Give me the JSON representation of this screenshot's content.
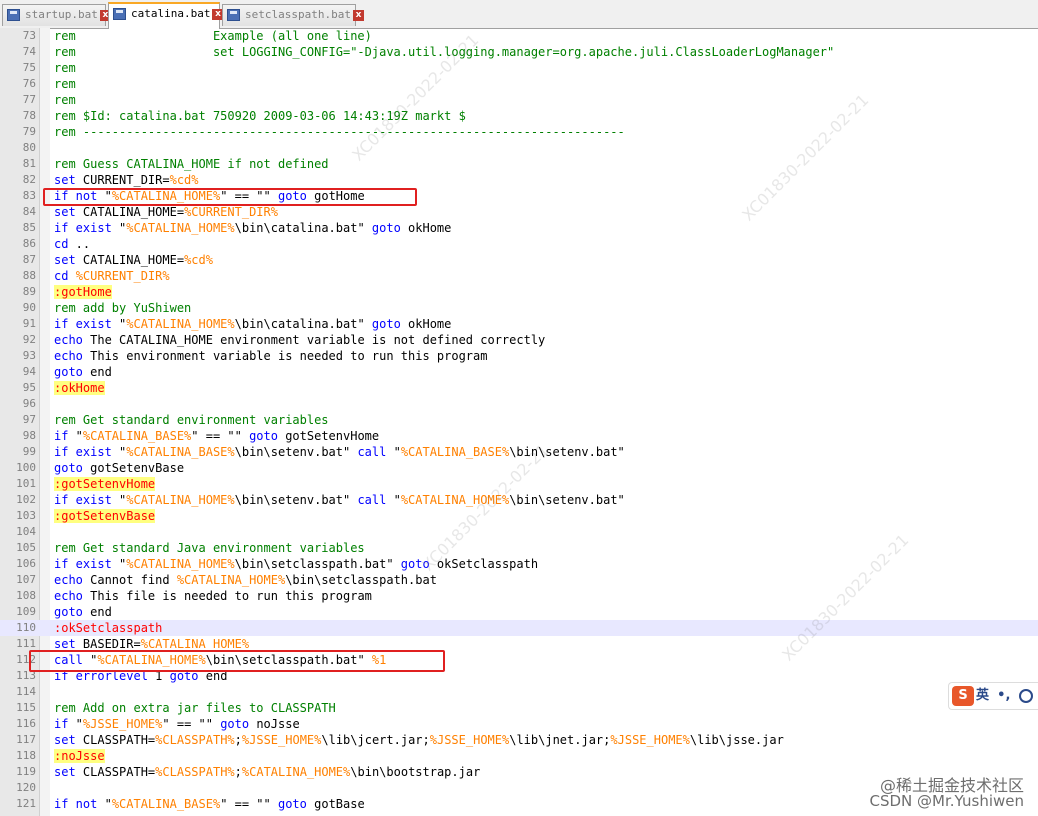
{
  "tabs": [
    {
      "label": "startup.bat",
      "active": false
    },
    {
      "label": "catalina.bat",
      "active": true
    },
    {
      "label": "setclasspath.bat",
      "active": false
    }
  ],
  "lines": [
    {
      "n": "73",
      "t": [
        [
          "cm",
          "rem                   Example (all one line)"
        ]
      ]
    },
    {
      "n": "74",
      "t": [
        [
          "cm",
          "rem                   set LOGGING_CONFIG=\"-Djava.util.logging.manager=org.apache.juli.ClassLoaderLogManager\""
        ]
      ]
    },
    {
      "n": "75",
      "t": [
        [
          "cm",
          "rem"
        ]
      ]
    },
    {
      "n": "76",
      "t": [
        [
          "cm",
          "rem"
        ]
      ]
    },
    {
      "n": "77",
      "t": [
        [
          "cm",
          "rem"
        ]
      ]
    },
    {
      "n": "78",
      "t": [
        [
          "cm",
          "rem $Id: catalina.bat 750920 2009-03-06 14:43:19Z markt $"
        ]
      ]
    },
    {
      "n": "79",
      "t": [
        [
          "cm",
          "rem ---------------------------------------------------------------------------"
        ]
      ]
    },
    {
      "n": "80",
      "t": []
    },
    {
      "n": "81",
      "t": [
        [
          "cm",
          "rem Guess CATALINA_HOME if not defined"
        ]
      ]
    },
    {
      "n": "82",
      "t": [
        [
          "kw",
          "set"
        ],
        [
          "st",
          " CURRENT_DIR="
        ],
        [
          "vr",
          "%cd%"
        ]
      ]
    },
    {
      "n": "83",
      "t": [
        [
          "kw",
          "if not"
        ],
        [
          "st",
          " \""
        ],
        [
          "vr",
          "%CATALINA_HOME%"
        ],
        [
          "st",
          "\" == \"\" "
        ],
        [
          "kw",
          "goto"
        ],
        [
          "st",
          " gotHome"
        ]
      ]
    },
    {
      "n": "84",
      "t": [
        [
          "kw",
          "set"
        ],
        [
          "st",
          " CATALINA_HOME="
        ],
        [
          "vr",
          "%CURRENT_DIR%"
        ]
      ]
    },
    {
      "n": "85",
      "t": [
        [
          "kw",
          "if exist"
        ],
        [
          "st",
          " \""
        ],
        [
          "vr",
          "%CATALINA_HOME%"
        ],
        [
          "st",
          "\\bin\\catalina.bat\" "
        ],
        [
          "kw",
          "goto"
        ],
        [
          "st",
          " okHome"
        ]
      ]
    },
    {
      "n": "86",
      "t": [
        [
          "kw",
          "cd"
        ],
        [
          "st",
          " .."
        ]
      ]
    },
    {
      "n": "87",
      "t": [
        [
          "kw",
          "set"
        ],
        [
          "st",
          " CATALINA_HOME="
        ],
        [
          "vr",
          "%cd%"
        ]
      ]
    },
    {
      "n": "88",
      "t": [
        [
          "kw",
          "cd"
        ],
        [
          "st",
          " "
        ],
        [
          "vr",
          "%CURRENT_DIR%"
        ]
      ]
    },
    {
      "n": "89",
      "t": [
        [
          "lb",
          ":gotHome"
        ]
      ]
    },
    {
      "n": "90",
      "t": [
        [
          "cm",
          "rem add by YuShiwen"
        ]
      ]
    },
    {
      "n": "91",
      "t": [
        [
          "kw",
          "if exist"
        ],
        [
          "st",
          " \""
        ],
        [
          "vr",
          "%CATALINA_HOME%"
        ],
        [
          "st",
          "\\bin\\catalina.bat\" "
        ],
        [
          "kw",
          "goto"
        ],
        [
          "st",
          " okHome"
        ]
      ]
    },
    {
      "n": "92",
      "t": [
        [
          "kw",
          "echo"
        ],
        [
          "st",
          " The CATALINA_HOME environment variable is not defined correctly"
        ]
      ]
    },
    {
      "n": "93",
      "t": [
        [
          "kw",
          "echo"
        ],
        [
          "st",
          " This environment variable is needed to run this program"
        ]
      ]
    },
    {
      "n": "94",
      "t": [
        [
          "kw",
          "goto"
        ],
        [
          "st",
          " end"
        ]
      ]
    },
    {
      "n": "95",
      "t": [
        [
          "lb",
          ":okHome"
        ]
      ]
    },
    {
      "n": "96",
      "t": []
    },
    {
      "n": "97",
      "t": [
        [
          "cm",
          "rem Get standard environment variables"
        ]
      ]
    },
    {
      "n": "98",
      "t": [
        [
          "kw",
          "if"
        ],
        [
          "st",
          " \""
        ],
        [
          "vr",
          "%CATALINA_BASE%"
        ],
        [
          "st",
          "\" == \"\" "
        ],
        [
          "kw",
          "goto"
        ],
        [
          "st",
          " gotSetenvHome"
        ]
      ]
    },
    {
      "n": "99",
      "t": [
        [
          "kw",
          "if exist"
        ],
        [
          "st",
          " \""
        ],
        [
          "vr",
          "%CATALINA_BASE%"
        ],
        [
          "st",
          "\\bin\\setenv.bat\" "
        ],
        [
          "kw",
          "call"
        ],
        [
          "st",
          " \""
        ],
        [
          "vr",
          "%CATALINA_BASE%"
        ],
        [
          "st",
          "\\bin\\setenv.bat\""
        ]
      ]
    },
    {
      "n": "100",
      "t": [
        [
          "kw",
          "goto"
        ],
        [
          "st",
          " gotSetenvBase"
        ]
      ]
    },
    {
      "n": "101",
      "t": [
        [
          "lb",
          ":gotSetenvHome"
        ]
      ]
    },
    {
      "n": "102",
      "t": [
        [
          "kw",
          "if exist"
        ],
        [
          "st",
          " \""
        ],
        [
          "vr",
          "%CATALINA_HOME%"
        ],
        [
          "st",
          "\\bin\\setenv.bat\" "
        ],
        [
          "kw",
          "call"
        ],
        [
          "st",
          " \""
        ],
        [
          "vr",
          "%CATALINA_HOME%"
        ],
        [
          "st",
          "\\bin\\setenv.bat\""
        ]
      ]
    },
    {
      "n": "103",
      "t": [
        [
          "lb",
          ":gotSetenvBase"
        ]
      ]
    },
    {
      "n": "104",
      "t": []
    },
    {
      "n": "105",
      "t": [
        [
          "cm",
          "rem Get standard Java environment variables"
        ]
      ]
    },
    {
      "n": "106",
      "t": [
        [
          "kw",
          "if exist"
        ],
        [
          "st",
          " \""
        ],
        [
          "vr",
          "%CATALINA_HOME%"
        ],
        [
          "st",
          "\\bin\\setclasspath.bat\" "
        ],
        [
          "kw",
          "goto"
        ],
        [
          "st",
          " okSetclasspath"
        ]
      ]
    },
    {
      "n": "107",
      "t": [
        [
          "kw",
          "echo"
        ],
        [
          "st",
          " Cannot find "
        ],
        [
          "vr",
          "%CATALINA_HOME%"
        ],
        [
          "st",
          "\\bin\\setclasspath.bat"
        ]
      ]
    },
    {
      "n": "108",
      "t": [
        [
          "kw",
          "echo"
        ],
        [
          "st",
          " This file is needed to run this program"
        ]
      ]
    },
    {
      "n": "109",
      "t": [
        [
          "kw",
          "goto"
        ],
        [
          "st",
          " end"
        ]
      ]
    },
    {
      "n": "110",
      "t": [
        [
          "lbc",
          ":okSetclasspath"
        ]
      ],
      "current": true
    },
    {
      "n": "111",
      "t": [
        [
          "kw",
          "set"
        ],
        [
          "st",
          " BASEDIR="
        ],
        [
          "vr",
          "%CATALINA_HOME%"
        ]
      ]
    },
    {
      "n": "112",
      "t": [
        [
          "kw",
          "call"
        ],
        [
          "st",
          " \""
        ],
        [
          "vr",
          "%CATALINA_HOME%"
        ],
        [
          "st",
          "\\bin\\setclasspath.bat\" "
        ],
        [
          "vr",
          "%1"
        ]
      ]
    },
    {
      "n": "113",
      "t": [
        [
          "kw",
          "if errorlevel"
        ],
        [
          "st",
          " 1 "
        ],
        [
          "kw",
          "goto"
        ],
        [
          "st",
          " end"
        ]
      ]
    },
    {
      "n": "114",
      "t": []
    },
    {
      "n": "115",
      "t": [
        [
          "cm",
          "rem Add on extra jar files to CLASSPATH"
        ]
      ]
    },
    {
      "n": "116",
      "t": [
        [
          "kw",
          "if"
        ],
        [
          "st",
          " \""
        ],
        [
          "vr",
          "%JSSE_HOME%"
        ],
        [
          "st",
          "\" == \"\" "
        ],
        [
          "kw",
          "goto"
        ],
        [
          "st",
          " noJsse"
        ]
      ]
    },
    {
      "n": "117",
      "t": [
        [
          "kw",
          "set"
        ],
        [
          "st",
          " CLASSPATH="
        ],
        [
          "vr",
          "%CLASSPATH%"
        ],
        [
          "st",
          ";"
        ],
        [
          "vr",
          "%JSSE_HOME%"
        ],
        [
          "st",
          "\\lib\\jcert.jar;"
        ],
        [
          "vr",
          "%JSSE_HOME%"
        ],
        [
          "st",
          "\\lib\\jnet.jar;"
        ],
        [
          "vr",
          "%JSSE_HOME%"
        ],
        [
          "st",
          "\\lib\\jsse.jar"
        ]
      ]
    },
    {
      "n": "118",
      "t": [
        [
          "lb",
          ":noJsse"
        ]
      ]
    },
    {
      "n": "119",
      "t": [
        [
          "kw",
          "set"
        ],
        [
          "st",
          " CLASSPATH="
        ],
        [
          "vr",
          "%CLASSPATH%"
        ],
        [
          "st",
          ";"
        ],
        [
          "vr",
          "%CATALINA_HOME%"
        ],
        [
          "st",
          "\\bin\\bootstrap.jar"
        ]
      ]
    },
    {
      "n": "120",
      "t": []
    },
    {
      "n": "121",
      "t": [
        [
          "kw",
          "if not"
        ],
        [
          "st",
          " \""
        ],
        [
          "vr",
          "%CATALINA_BASE%"
        ],
        [
          "st",
          "\" == \"\" "
        ],
        [
          "kw",
          "goto"
        ],
        [
          "st",
          " gotBase"
        ]
      ]
    }
  ],
  "ime": {
    "char": "英",
    "punct": "•,"
  },
  "credits": {
    "site": "@稀土掘金技术社区",
    "author": "CSDN @Mr.Yushiwen"
  },
  "colors": {
    "keyword": "#0000ff",
    "comment": "#008000",
    "variable": "#ff8000",
    "label": "#ff0000",
    "label_bg": "#ffff80",
    "annotation": "#e02020",
    "tab_accent": "#f9a825"
  }
}
